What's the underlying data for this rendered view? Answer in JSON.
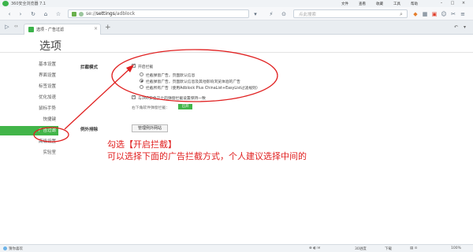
{
  "window": {
    "title": "360安全浏览器 7.1",
    "menus": [
      "文件",
      "查看",
      "收藏",
      "工具",
      "帮助"
    ]
  },
  "navbar": {
    "url_prefix": "se://",
    "url_path": "settings",
    "url_suffix": "/adblock",
    "search_placeholder": "点此搜索"
  },
  "tabs": {
    "active_title": "选项 - 广告过滤",
    "new_tab": "+"
  },
  "page": {
    "title": "选项",
    "sidebar": [
      {
        "label": "基本设置"
      },
      {
        "label": "界面设置"
      },
      {
        "label": "标签设置"
      },
      {
        "label": "优化加速"
      },
      {
        "label": "鼠标手势"
      },
      {
        "label": "快捷键"
      },
      {
        "label": "广告过滤",
        "active": true
      },
      {
        "label": "高级设置"
      },
      {
        "label": "实验室"
      }
    ],
    "adblock": {
      "section_label": "拦截模式",
      "enable_label": "开启拦截",
      "options": [
        "拦截弹窗广告，页面默认信息",
        "拦截弹窗广告，页面默认信息及其他影响浏览体验的广告",
        "拦截所有广告（使用Adblock Plus ChinaList+EasyList过滤规则）"
      ],
      "sync_label": "与360安全卫士的弹窗拦截设置保持一致",
      "custom_rules_text": "右下角软件弹窗拦截：",
      "custom_rules_button": "已开"
    },
    "exceptions": {
      "section_label": "例外排除",
      "button": "管理例外网站"
    }
  },
  "annotation": {
    "line1": "勾选【开启拦截】",
    "line2": "可以选择下面的广告拦截方式，个人建议选择中间的"
  },
  "statusbar": {
    "left": "猜你喜欢",
    "right_items": [
      "30进度",
      "下载",
      "100%"
    ]
  },
  "colors": {
    "accent_green": "#42b549",
    "annotation_red": "#e02020"
  }
}
